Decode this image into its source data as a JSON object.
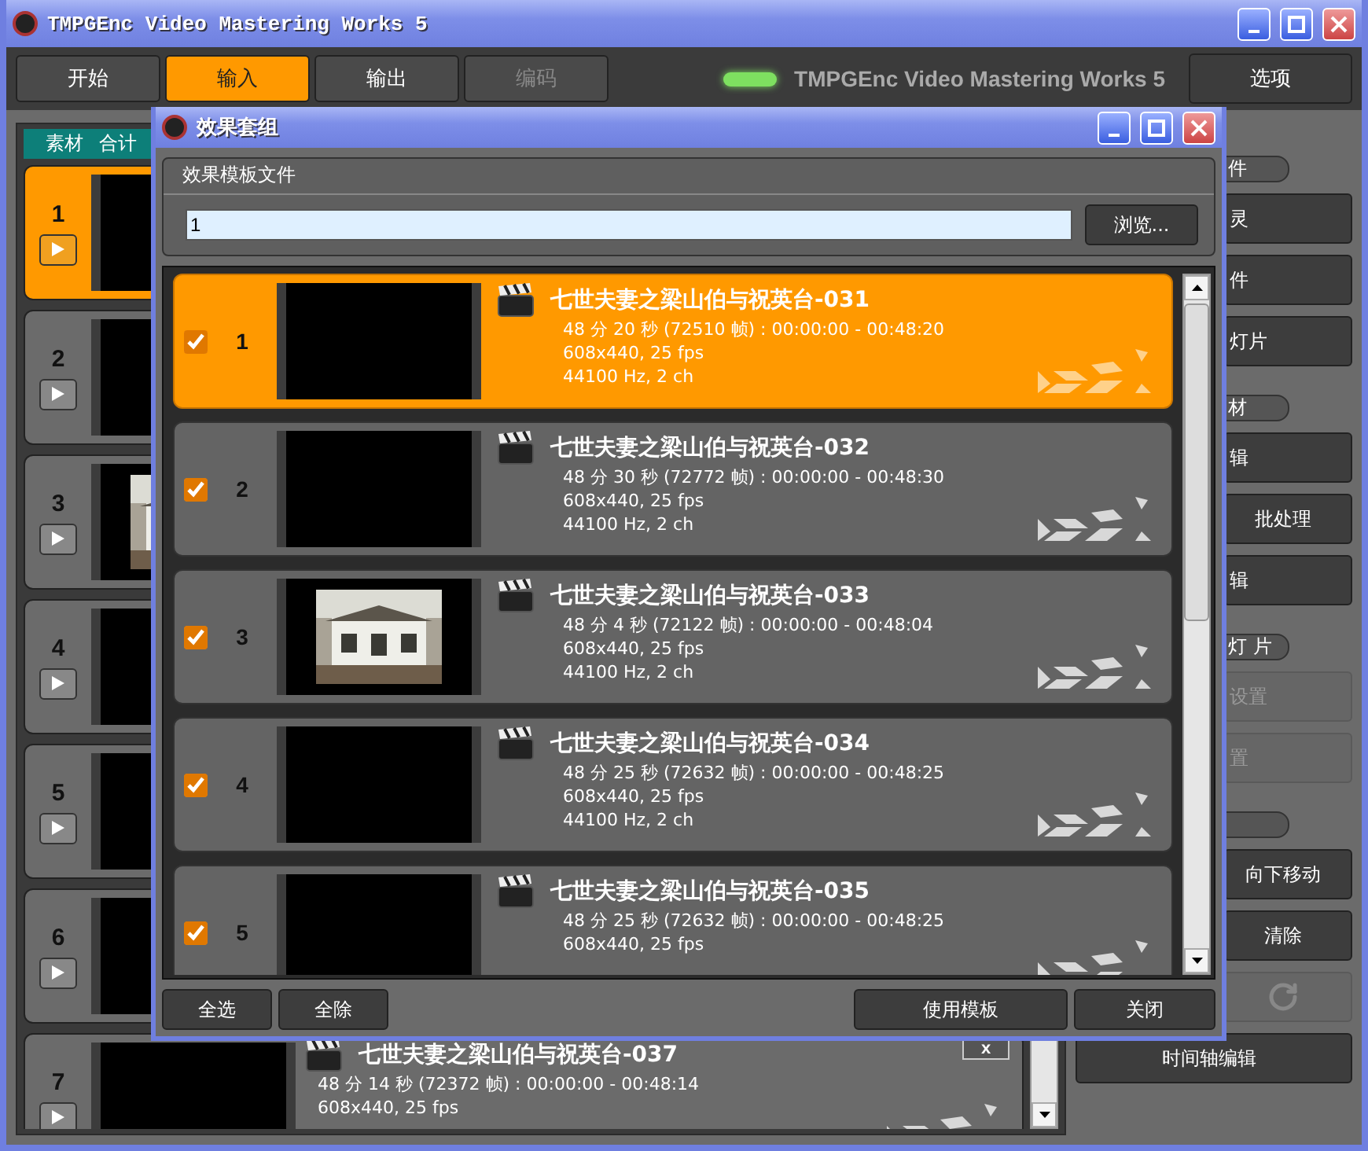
{
  "window": {
    "title": "TMPGEnc Video Mastering Works 5"
  },
  "toolbar": {
    "tabs": [
      {
        "label": "开始",
        "selected": false,
        "disabled": false
      },
      {
        "label": "输入",
        "selected": true,
        "disabled": false
      },
      {
        "label": "输出",
        "selected": false,
        "disabled": false
      },
      {
        "label": "编码",
        "selected": false,
        "disabled": true
      }
    ],
    "brand": "TMPGEnc Video Mastering Works 5",
    "options": "选项"
  },
  "source_panel": {
    "header": [
      "素材",
      "合计"
    ],
    "items": [
      {
        "number": "1",
        "selected": true,
        "has_picture": false
      },
      {
        "number": "2",
        "selected": false,
        "has_picture": false
      },
      {
        "number": "3",
        "selected": false,
        "has_picture": true
      },
      {
        "number": "4",
        "selected": false,
        "has_picture": false
      },
      {
        "number": "5",
        "selected": false,
        "has_picture": false
      },
      {
        "number": "6",
        "selected": false,
        "has_picture": false
      },
      {
        "number": "7",
        "selected": false,
        "has_picture": false,
        "title": "七世夫妻之梁山伯与祝英台-037",
        "lines": [
          "48 分 14 秒 (72372 帧) : 00:00:00 - 00:48:14",
          "608x440, 25 fps"
        ],
        "remove": "x"
      }
    ]
  },
  "right_panel": {
    "items": [
      {
        "kind": "pill",
        "label": "件"
      },
      {
        "kind": "cut",
        "label": "灵",
        "disabled": false
      },
      {
        "kind": "cut",
        "label": "件",
        "disabled": false
      },
      {
        "kind": "cut",
        "label": "灯片",
        "disabled": false
      },
      {
        "kind": "pill",
        "label": "材"
      },
      {
        "kind": "cut",
        "label": "辑",
        "disabled": false
      },
      {
        "kind": "pair",
        "label": "批处理",
        "disabled": false
      },
      {
        "kind": "cut",
        "label": "辑",
        "disabled": false
      },
      {
        "kind": "pill",
        "label": "灯 片"
      },
      {
        "kind": "cut",
        "label": "设置",
        "disabled": true
      },
      {
        "kind": "cut",
        "label": "置",
        "disabled": true
      },
      {
        "kind": "pill"
      },
      {
        "kind": "pair",
        "label": "向下移动",
        "disabled": false
      },
      {
        "kind": "pair",
        "label": "清除",
        "disabled": false
      },
      {
        "kind": "refresh",
        "disabled": true
      },
      {
        "kind": "full",
        "label": "时间轴编辑",
        "disabled": false
      }
    ]
  },
  "dialog": {
    "title": "效果套组",
    "template_group": {
      "label": "效果模板文件",
      "value": "1",
      "browse": "浏览..."
    },
    "clips": [
      {
        "number": "1",
        "checked": true,
        "selected": true,
        "has_picture": false,
        "title": "七世夫妻之梁山伯与祝英台-031",
        "lines": [
          "48 分 20 秒 (72510 帧) : 00:00:00 - 00:48:20",
          "608x440, 25 fps",
          "44100 Hz, 2 ch"
        ]
      },
      {
        "number": "2",
        "checked": true,
        "selected": false,
        "has_picture": false,
        "title": "七世夫妻之梁山伯与祝英台-032",
        "lines": [
          "48 分 30 秒 (72772 帧) : 00:00:00 - 00:48:30",
          "608x440, 25 fps",
          "44100 Hz, 2 ch"
        ]
      },
      {
        "number": "3",
        "checked": true,
        "selected": false,
        "has_picture": true,
        "title": "七世夫妻之梁山伯与祝英台-033",
        "lines": [
          "48 分 4 秒 (72122 帧) : 00:00:00 - 00:48:04",
          "608x440, 25 fps",
          "44100 Hz, 2 ch"
        ]
      },
      {
        "number": "4",
        "checked": true,
        "selected": false,
        "has_picture": false,
        "title": "七世夫妻之梁山伯与祝英台-034",
        "lines": [
          "48 分 25 秒 (72632 帧) : 00:00:00 - 00:48:25",
          "608x440, 25 fps",
          "44100 Hz, 2 ch"
        ]
      },
      {
        "number": "5",
        "checked": true,
        "selected": false,
        "has_picture": false,
        "title": "七世夫妻之梁山伯与祝英台-035",
        "lines": [
          "48 分 25 秒 (72632 帧) : 00:00:00 - 00:48:25",
          "608x440, 25 fps"
        ]
      }
    ],
    "left_buttons": [
      "全选",
      "全除"
    ],
    "right_buttons": [
      "使用模板",
      "关闭"
    ]
  }
}
